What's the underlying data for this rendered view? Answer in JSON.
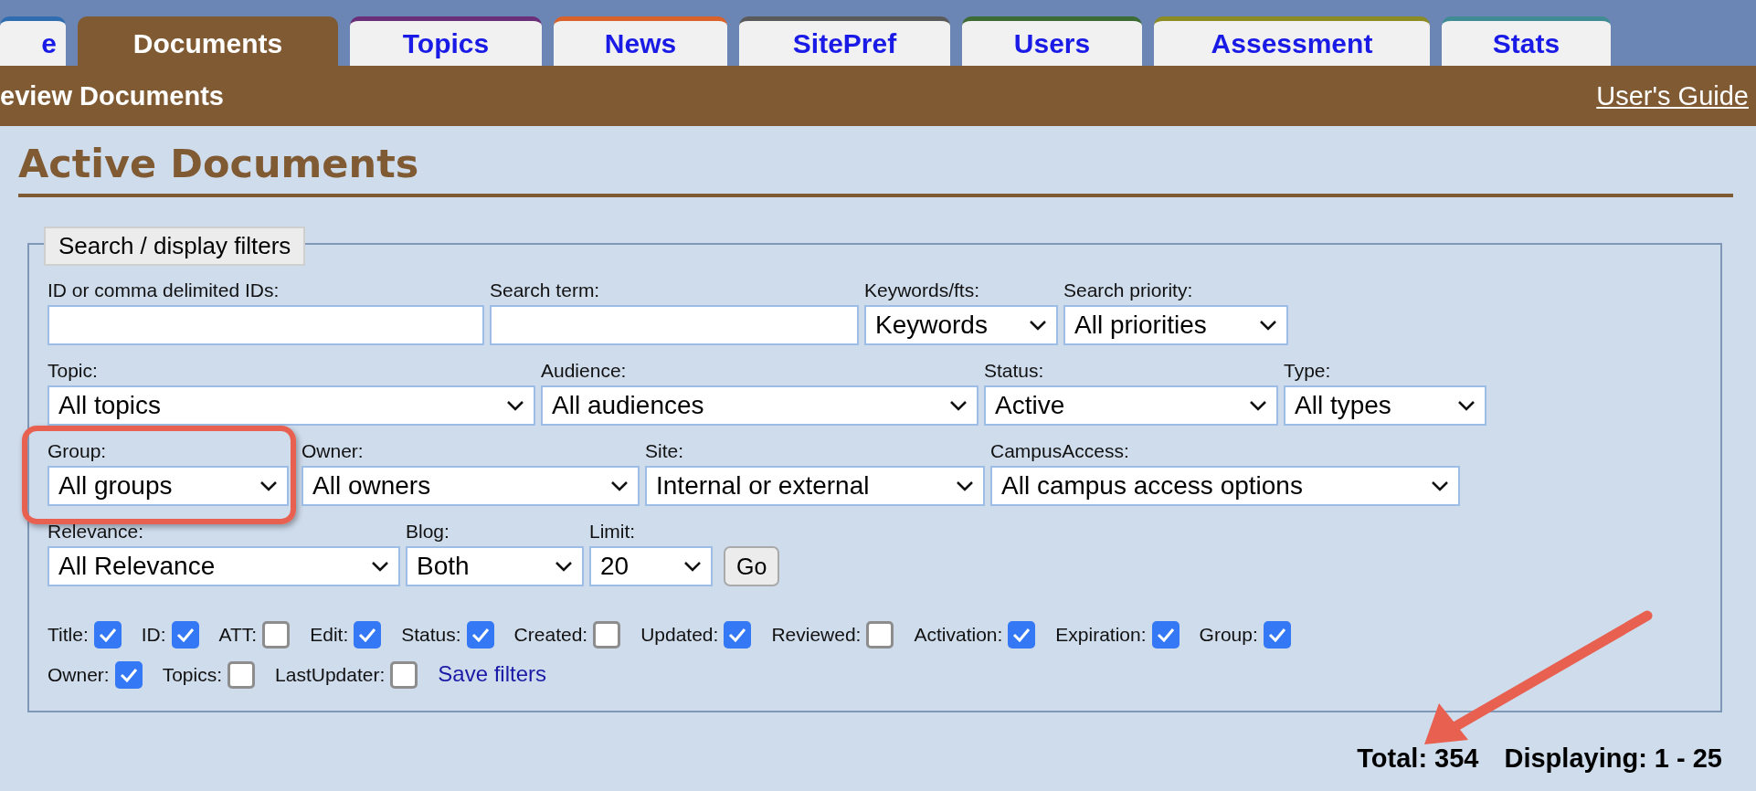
{
  "tabs": [
    {
      "label": "e",
      "selected": false,
      "color": "#2f6db0"
    },
    {
      "label": "Documents",
      "selected": true,
      "color": "#7f5a33"
    },
    {
      "label": "Topics",
      "selected": false,
      "color": "#6b2f7a"
    },
    {
      "label": "News",
      "selected": false,
      "color": "#d9622b"
    },
    {
      "label": "SitePref",
      "selected": false,
      "color": "#5a5a5a"
    },
    {
      "label": "Users",
      "selected": false,
      "color": "#3d6b35"
    },
    {
      "label": "Assessment",
      "selected": false,
      "color": "#8c8c25"
    },
    {
      "label": "Stats",
      "selected": false,
      "color": "#3f8c95"
    }
  ],
  "header": {
    "title": "eview Documents",
    "link": "User's Guide"
  },
  "heading": "Active Documents",
  "filters": {
    "legend": "Search / display filters",
    "field_lines": [
      [
        {
          "kind": "text",
          "label": "ID or comma delimited IDs:"
        },
        {
          "kind": "text",
          "label": "Search term:"
        },
        {
          "kind": "select",
          "label": "Keywords/fts:",
          "value": "Keywords"
        },
        {
          "kind": "select",
          "label": "Search priority:",
          "value": "All priorities"
        }
      ],
      [
        {
          "kind": "select",
          "label": "Topic:",
          "value": "All topics"
        },
        {
          "kind": "select",
          "label": "Audience:",
          "value": "All audiences"
        },
        {
          "kind": "select",
          "label": "Status:",
          "value": "Active"
        },
        {
          "kind": "select",
          "label": "Type:",
          "value": "All types"
        }
      ],
      [
        {
          "kind": "select",
          "label": "Group:",
          "value": "All groups",
          "highlighted": true
        },
        {
          "kind": "select",
          "label": "Owner:",
          "value": "All owners"
        },
        {
          "kind": "select",
          "label": "Site:",
          "value": "Internal or external"
        },
        {
          "kind": "select",
          "label": "CampusAccess:",
          "value": "All campus access options"
        }
      ],
      [
        {
          "kind": "select",
          "label": "Relevance:",
          "value": "All Relevance"
        },
        {
          "kind": "select",
          "label": "Blog:",
          "value": "Both"
        },
        {
          "kind": "select",
          "label": "Limit:",
          "value": "20"
        },
        {
          "kind": "button",
          "value": "Go"
        }
      ]
    ],
    "columns": [
      {
        "label": "Title:",
        "checked": true
      },
      {
        "label": "ID:",
        "checked": true
      },
      {
        "label": "ATT:",
        "checked": false
      },
      {
        "label": "Edit:",
        "checked": true
      },
      {
        "label": "Status:",
        "checked": true
      },
      {
        "label": "Created:",
        "checked": false
      },
      {
        "label": "Updated:",
        "checked": true
      },
      {
        "label": "Reviewed:",
        "checked": false
      },
      {
        "label": "Activation:",
        "checked": true
      },
      {
        "label": "Expiration:",
        "checked": true
      },
      {
        "label": "Group:",
        "checked": true
      },
      {
        "label": "Owner:",
        "checked": true
      },
      {
        "label": "Topics:",
        "checked": false
      },
      {
        "label": "LastUpdater:",
        "checked": false
      }
    ],
    "save_link": "Save filters"
  },
  "summary": {
    "total": "Total: 354",
    "displaying": "Displaying: 1 - 25"
  }
}
